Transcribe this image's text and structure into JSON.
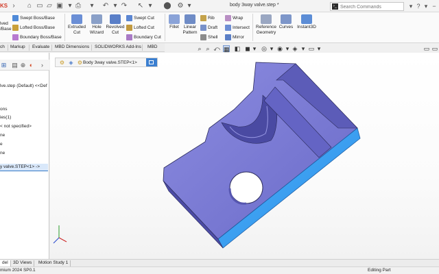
{
  "titlebar": {
    "app_fragment": "KS",
    "document_title": "body 3way valve.step *",
    "search_placeholder": "Search Commands"
  },
  "ribbon": {
    "left_fragment_1": "lved",
    "left_fragment_2": "/Base",
    "swept_boss": "Swept Boss/Base",
    "lofted_boss": "Lofted Boss/Base",
    "boundary_boss": "Boundary Boss/Base",
    "extruded_cut": "Extruded\nCut",
    "hole_wizard": "Hole\nWizard",
    "revolved_cut": "Revolved\nCut",
    "swept_cut": "Swept Cut",
    "lofted_cut": "Lofted Cut",
    "boundary_cut": "Boundary Cut",
    "fillet": "Fillet",
    "linear_pattern": "Linear\nPattern",
    "rib": "Rib",
    "draft": "Draft",
    "shell": "Shell",
    "wrap": "Wrap",
    "intersect": "Intersect",
    "mirror": "Mirror",
    "reference_geometry": "Reference\nGeometry",
    "curves": "Curves",
    "instant3d": "Instant3D"
  },
  "tabs": [
    "ch",
    "Markup",
    "Evaluate",
    "MBD Dimensions",
    "SOLIDWORKS Add-Ins",
    "MBD"
  ],
  "feature_tree": {
    "lines": [
      "lve.step (Default) <<Def",
      "ons",
      "ies(1)",
      "< not specified>",
      "ne",
      "e",
      "ne"
    ],
    "selected": "y valve.STEP<1> ->"
  },
  "breadcrumb": {
    "label": "Body 3way valve.STEP<1>"
  },
  "bottom_tabs": [
    "del",
    "3D Views",
    "Motion Study 1"
  ],
  "status": {
    "left": "mium 2024 SP0.1",
    "right": "Editing Part"
  },
  "colors": {
    "part_face": "#7b7bd6",
    "part_dark": "#4d4da8",
    "part_highlight": "#3399f3",
    "selection_blue": "#3b7fd0"
  }
}
